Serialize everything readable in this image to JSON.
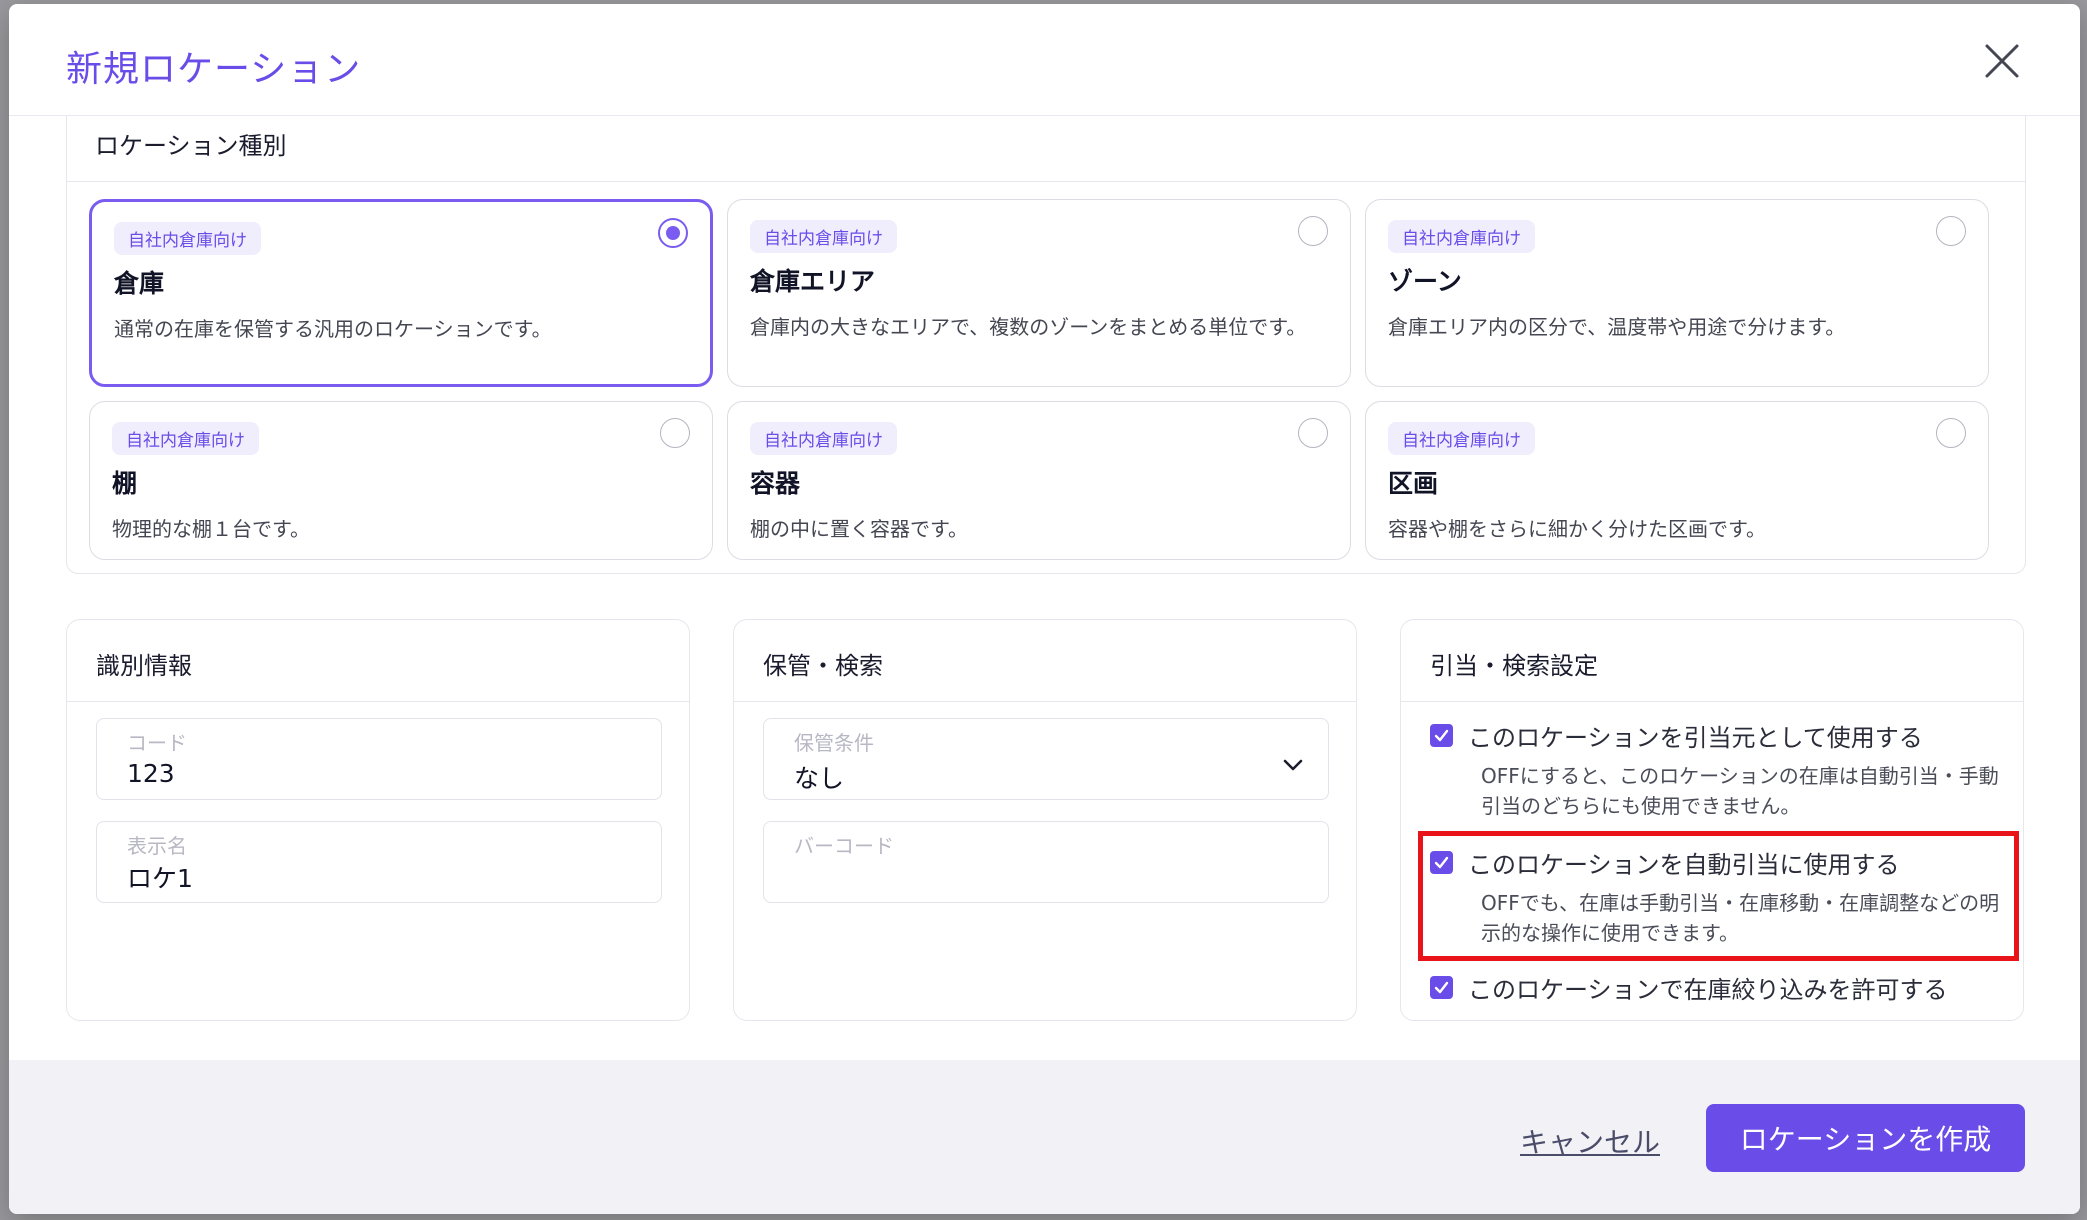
{
  "modal": {
    "title": "新規ロケーション"
  },
  "location_type": {
    "heading": "ロケーション種別",
    "cards": [
      {
        "badge": "自社内倉庫向け",
        "name": "倉庫",
        "desc": "通常の在庫を保管する汎用のロケーションです。",
        "selected": true
      },
      {
        "badge": "自社内倉庫向け",
        "name": "倉庫エリア",
        "desc": "倉庫内の大きなエリアで、複数のゾーンをまとめる単位です。",
        "selected": false
      },
      {
        "badge": "自社内倉庫向け",
        "name": "ゾーン",
        "desc": "倉庫エリア内の区分で、温度帯や用途で分けます。",
        "selected": false
      },
      {
        "badge": "自社内倉庫向け",
        "name": "棚",
        "desc": "物理的な棚１台です。",
        "selected": false
      },
      {
        "badge": "自社内倉庫向け",
        "name": "容器",
        "desc": "棚の中に置く容器です。",
        "selected": false
      },
      {
        "badge": "自社内倉庫向け",
        "name": "区画",
        "desc": "容器や棚をさらに細かく分けた区画です。",
        "selected": false
      }
    ]
  },
  "identification": {
    "heading": "識別情報",
    "code_label": "コード",
    "code_value": "123",
    "display_name_label": "表示名",
    "display_name_value": "ロケ1"
  },
  "storage": {
    "heading": "保管・検索",
    "condition_label": "保管条件",
    "condition_value": "なし",
    "barcode_label": "バーコード",
    "barcode_value": ""
  },
  "allocation": {
    "heading": "引当・検索設定",
    "options": [
      {
        "label": "このロケーションを引当元として使用する",
        "note": "OFFにすると、このロケーションの在庫は自動引当・手動引当のどちらにも使用できません。",
        "checked": true
      },
      {
        "label": "このロケーションを自動引当に使用する",
        "note": "OFFでも、在庫は手動引当・在庫移動・在庫調整などの明示的な操作に使用できます。",
        "checked": true
      },
      {
        "label": "このロケーションで在庫絞り込みを許可する",
        "note": "",
        "checked": true
      }
    ]
  },
  "footer": {
    "cancel_label": "キャンセル",
    "create_label": "ロケーションを作成"
  },
  "colors": {
    "accent": "#6a4ce8",
    "highlight": "#e8141a"
  }
}
